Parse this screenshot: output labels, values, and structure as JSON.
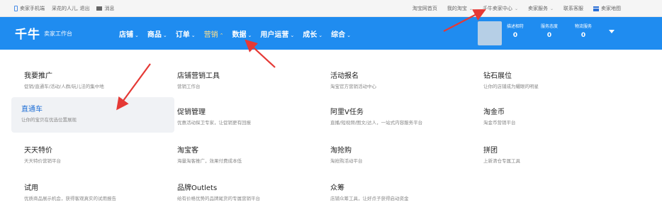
{
  "topbar": {
    "left": [
      "卖家手机端",
      "采花的人儿, 退出",
      "消息"
    ],
    "right": [
      "淘宝网首页",
      "我的淘宝",
      "千牛卖家中心",
      "卖家服务",
      "联系客服",
      "卖家地图"
    ]
  },
  "header": {
    "logo": "千牛",
    "logo_sub": "卖家工作台",
    "nav": [
      "店铺",
      "商品",
      "订单",
      "营销",
      "数据",
      "用户运营",
      "成长",
      "综合"
    ],
    "stats": [
      {
        "label": "描述相符",
        "value": "0"
      },
      {
        "label": "服务态度",
        "value": "0"
      },
      {
        "label": "物流服务",
        "value": "0"
      }
    ]
  },
  "menu": [
    {
      "title": "我要推广",
      "desc": "促销/直通车/活动/人群/玩儿法的集中地"
    },
    {
      "title": "店铺营销工具",
      "desc": "营销工作台"
    },
    {
      "title": "活动报名",
      "desc": "淘宝官方营销活动中心"
    },
    {
      "title": "钻石展位",
      "desc": "让你的店铺成为耀眼的明星"
    },
    {
      "title": "直通车",
      "desc": "让你的宝贝在优选位置展现"
    },
    {
      "title": "促销管理",
      "desc": "优惠活动探卫专家，让促销更有回报"
    },
    {
      "title": "阿里V任务",
      "desc": "直播/短视频/图文/达人，一站式内容服务平台"
    },
    {
      "title": "淘金币",
      "desc": "淘金币营销平台"
    },
    {
      "title": "天天特价",
      "desc": "天天特价营销平台"
    },
    {
      "title": "淘宝客",
      "desc": "海量淘客推广，效果付费成本低"
    },
    {
      "title": "淘抢购",
      "desc": "淘抢购活动平台"
    },
    {
      "title": "拼团",
      "desc": "上新清仓专属工具"
    },
    {
      "title": "试用",
      "desc": "优质商品展示机会，获得客观真实的试用报告"
    },
    {
      "title": "品牌Outlets",
      "desc": "给有价格优势的品牌尾货的专属营销平台"
    },
    {
      "title": "众筹",
      "desc": "店铺众筹工具，让好点子获得启动资金"
    }
  ],
  "colors": {
    "header_bg": "#1f8cf0",
    "active_nav": "#ffe08a",
    "highlight_title": "#1f6fd6",
    "arrow": "#e53935"
  },
  "icons": [
    "phone-icon",
    "mail-icon",
    "menu-icon",
    "caret-down-icon"
  ]
}
